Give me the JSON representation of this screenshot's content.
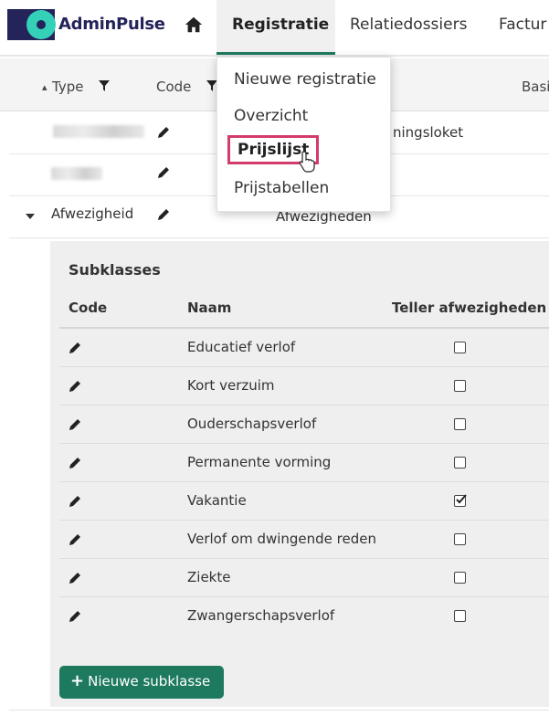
{
  "app": {
    "brand": "AdminPulse"
  },
  "nav": {
    "tabs": [
      {
        "label": "Registratie",
        "active": true
      },
      {
        "label": "Relatiedossiers",
        "active": false
      },
      {
        "label": "Factur",
        "active": false
      }
    ]
  },
  "menu": {
    "items": [
      {
        "label": "Nieuwe registratie"
      },
      {
        "label": "Overzicht"
      },
      {
        "label": "Prijslijst",
        "highlighted": true
      },
      {
        "label": "Prijstabellen"
      }
    ]
  },
  "columns": {
    "sort_indicator": "▴",
    "type": "Type",
    "code": "Code",
    "basis": "Basi"
  },
  "rows": [
    {
      "type": "",
      "extra": "ningsloket"
    },
    {
      "type": "",
      "extra": ""
    },
    {
      "type": "Afwezigheid",
      "extra": "Afwezigheden",
      "expanded": true
    }
  ],
  "subklasses": {
    "title": "Subklasses",
    "headers": {
      "code": "Code",
      "naam": "Naam",
      "teller": "Teller afwezigheden"
    },
    "rows": [
      {
        "naam": "Educatief verlof",
        "teller": false
      },
      {
        "naam": "Kort verzuim",
        "teller": false
      },
      {
        "naam": "Ouderschapsverlof",
        "teller": false
      },
      {
        "naam": "Permanente vorming",
        "teller": false
      },
      {
        "naam": "Vakantie",
        "teller": true
      },
      {
        "naam": "Verlof om dwingende reden",
        "teller": false
      },
      {
        "naam": "Ziekte",
        "teller": false
      },
      {
        "naam": "Zwangerschapsverlof",
        "teller": false
      }
    ],
    "new_button": "Nieuwe subklasse"
  },
  "colors": {
    "brand_navy": "#24235a",
    "brand_teal": "#35d0b8",
    "primary_green": "#1d7a5f",
    "highlight_pink": "#d23b6a"
  },
  "icons": [
    "home-icon",
    "filter-icon",
    "pencil-icon",
    "caret-down-icon",
    "checkbox-icon",
    "hand-pointer-cursor",
    "plus-icon"
  ]
}
